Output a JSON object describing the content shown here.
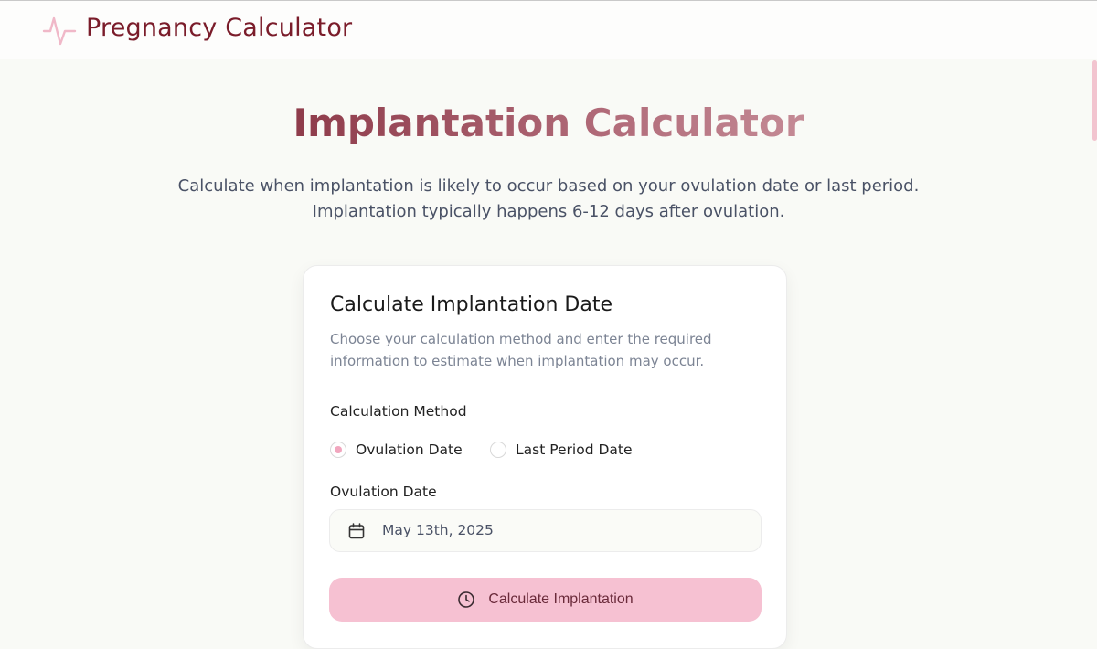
{
  "header": {
    "brand": "Pregnancy Calculator",
    "logo_icon": "heartbeat-icon",
    "accent_color": "#7a1c2a"
  },
  "hero": {
    "title": "Implantation Calculator",
    "subtitle_line1": "Calculate when implantation is likely to occur based on your ovulation date or last period.",
    "subtitle_line2": "Implantation typically happens 6-12 days after ovulation."
  },
  "card": {
    "title": "Calculate Implantation Date",
    "description": "Choose your calculation method and enter the required information to estimate when implantation may occur.",
    "method_label": "Calculation Method",
    "methods": [
      {
        "label": "Ovulation Date",
        "selected": true
      },
      {
        "label": "Last Period Date",
        "selected": false
      }
    ],
    "date_label": "Ovulation Date",
    "date_value": "May 13th, 2025",
    "date_icon": "calendar-icon",
    "button_label": "Calculate Implantation",
    "button_icon": "clock-icon",
    "button_color": "#f6c1d2"
  }
}
